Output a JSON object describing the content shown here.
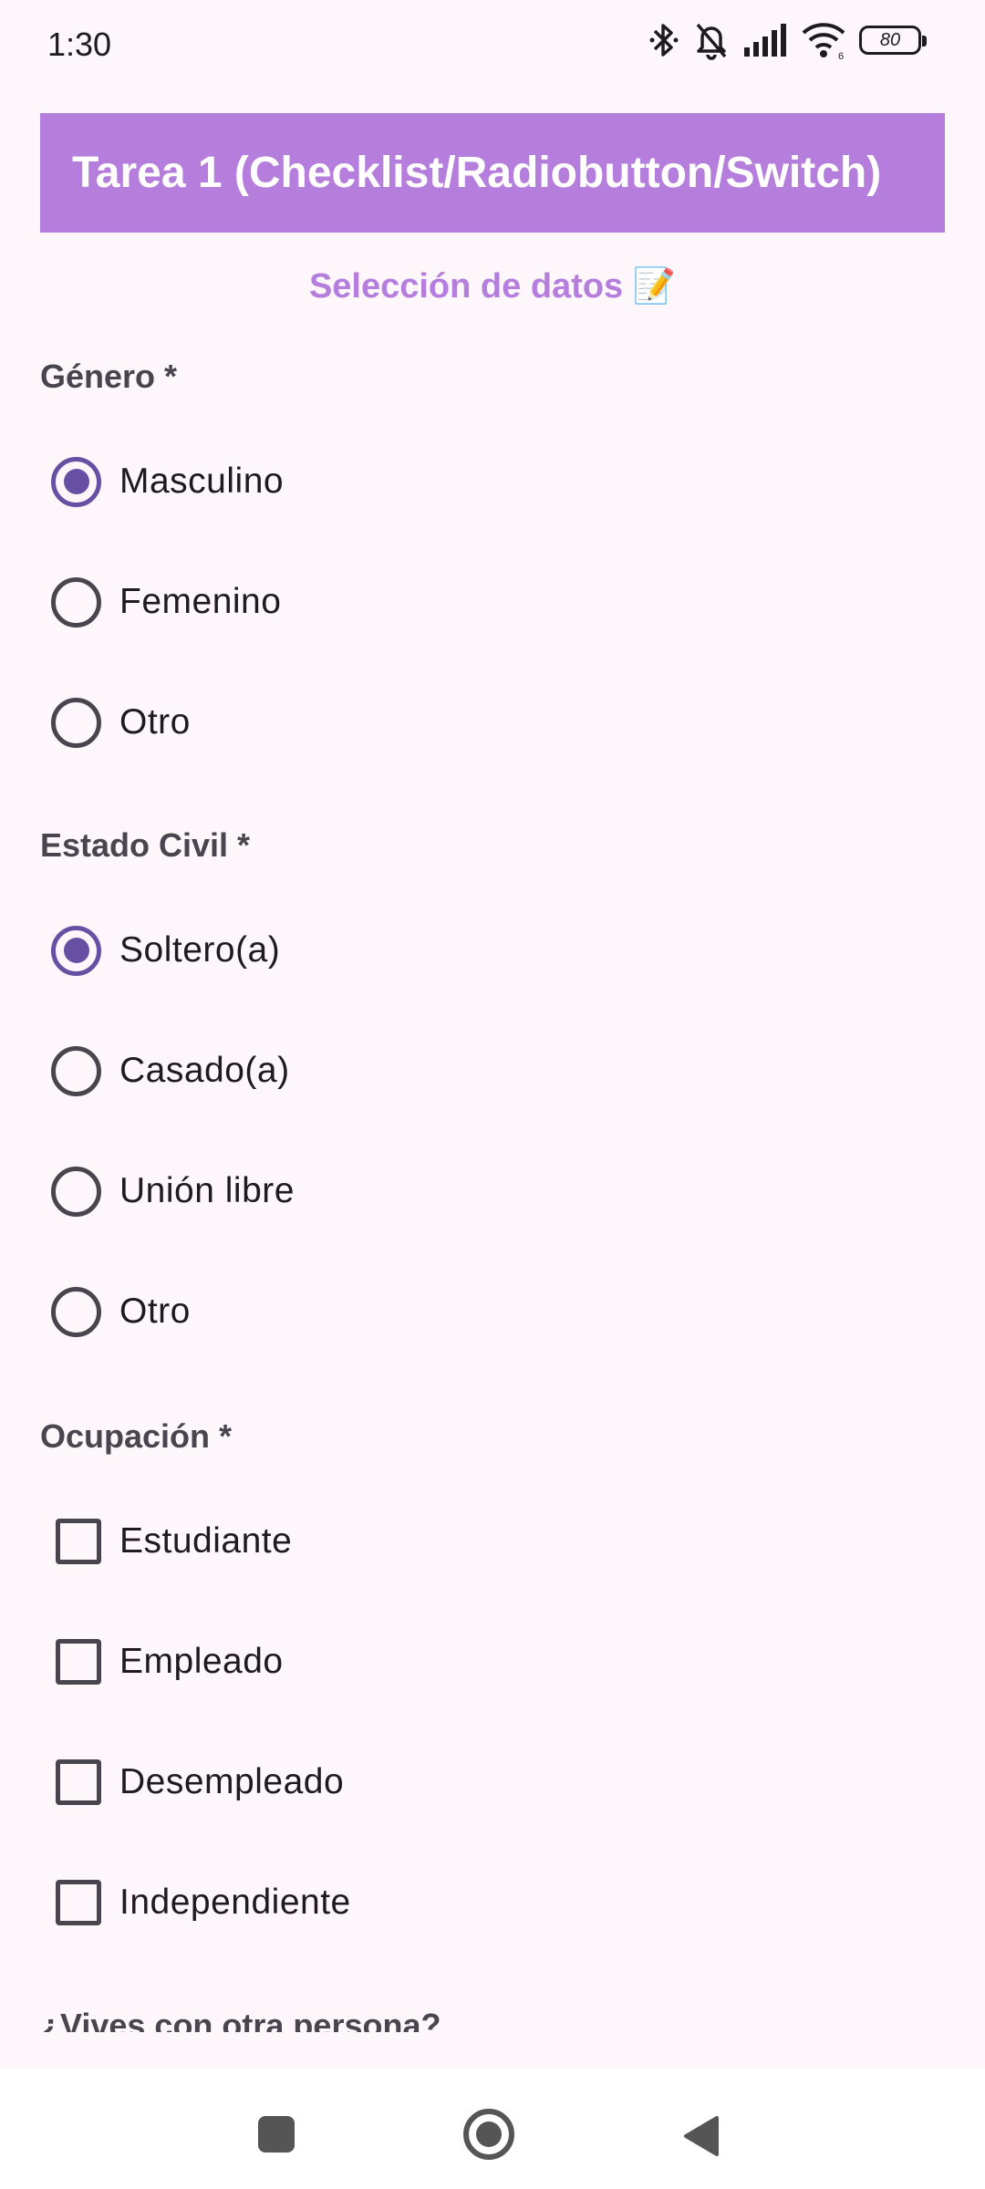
{
  "status_bar": {
    "time": "1:30",
    "battery": "80",
    "icons": [
      "bluetooth-icon",
      "bell-muted-icon",
      "signal-icon",
      "wifi-icon",
      "battery-icon"
    ]
  },
  "header": {
    "title": "Tarea 1 (Checklist/Radiobutton/Switch)"
  },
  "subtitle": "Selección de datos 📝",
  "genero": {
    "label": "Género *",
    "options": [
      {
        "label": "Masculino",
        "selected": true
      },
      {
        "label": "Femenino",
        "selected": false
      },
      {
        "label": "Otro",
        "selected": false
      }
    ]
  },
  "estado_civil": {
    "label": "Estado Civil *",
    "options": [
      {
        "label": "Soltero(a)",
        "selected": true
      },
      {
        "label": "Casado(a)",
        "selected": false
      },
      {
        "label": "Unión libre",
        "selected": false
      },
      {
        "label": "Otro",
        "selected": false
      }
    ]
  },
  "ocupacion": {
    "label": "Ocupación *",
    "options": [
      {
        "label": "Estudiante",
        "checked": false
      },
      {
        "label": "Empleado",
        "checked": false
      },
      {
        "label": "Desempleado",
        "checked": false
      },
      {
        "label": "Independiente",
        "checked": false
      }
    ]
  },
  "vives_label": "¿Vives con otra persona?",
  "colors": {
    "accent": "#B57EDC",
    "primary": "#6750A4",
    "background": "#FDF7FC"
  }
}
